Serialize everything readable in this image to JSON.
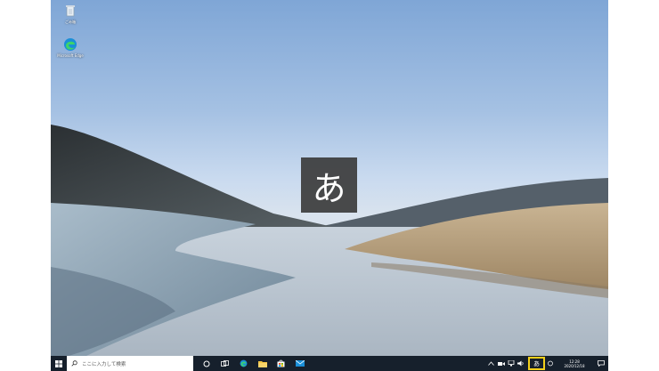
{
  "desktop": {
    "icons": [
      {
        "label": "ごみ箱",
        "icon": "recycle-bin-icon"
      },
      {
        "label": "Microsoft Edge",
        "icon": "edge-icon"
      }
    ],
    "ime_indicator": {
      "text": "あ"
    }
  },
  "taskbar": {
    "start_icon": "windows-logo-icon",
    "search": {
      "placeholder": "ここに入力して検索",
      "icon": "search-icon"
    },
    "pinned": [
      {
        "name": "cortana",
        "icon": "cortana-circle-icon"
      },
      {
        "name": "task-view",
        "icon": "task-view-icon"
      },
      {
        "name": "edge",
        "icon": "edge-icon"
      },
      {
        "name": "file-explorer",
        "icon": "folder-icon"
      },
      {
        "name": "store",
        "icon": "store-bag-icon"
      },
      {
        "name": "mail",
        "icon": "mail-icon"
      }
    ],
    "tray": {
      "ime_mode": "あ",
      "ime_highlight_color": "#f2cf1a",
      "time": "12:28",
      "date": "2020/12/18"
    }
  },
  "colors": {
    "taskbar_bg": "#16202c",
    "ime_overlay_bg": "#3c3c3c"
  }
}
